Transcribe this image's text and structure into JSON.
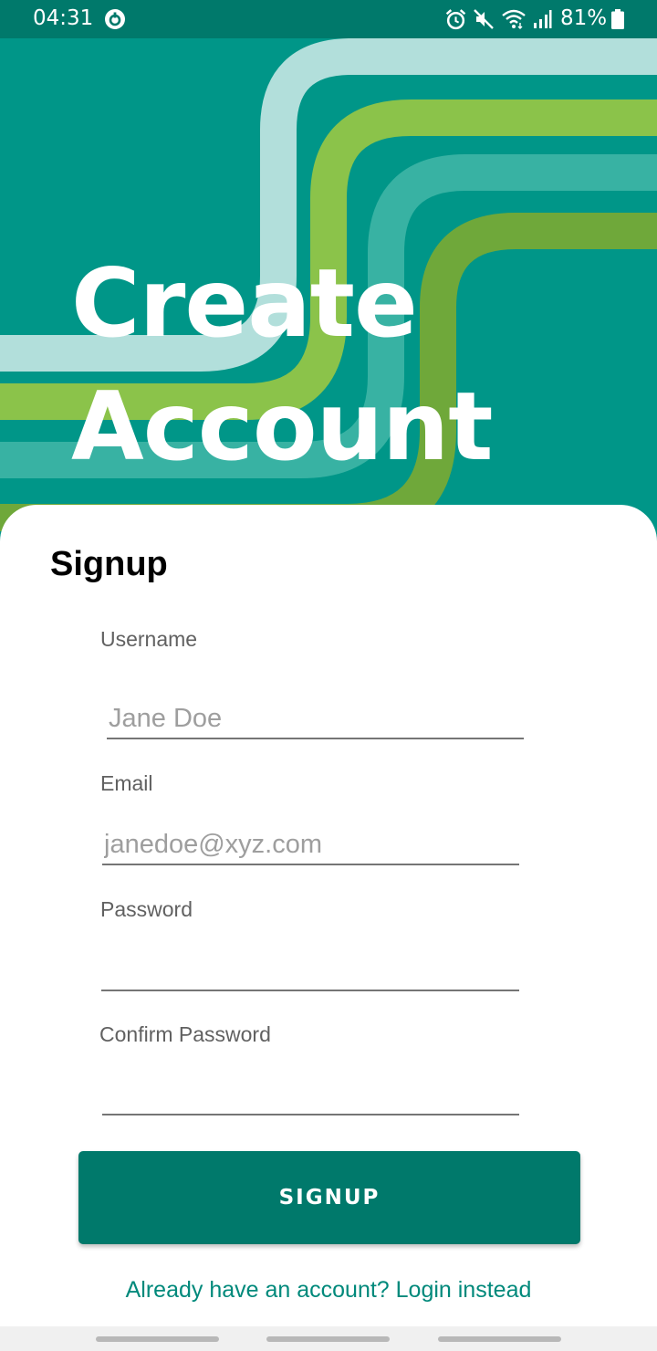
{
  "status_bar": {
    "time": "04:31",
    "battery": "81%",
    "icons": [
      "data-saver-icon",
      "alarm-icon",
      "mute-icon",
      "wifi-icon",
      "signal-icon",
      "battery-icon"
    ]
  },
  "header": {
    "title_line1": "Create",
    "title_line2": "Account"
  },
  "form": {
    "title": "Signup",
    "username": {
      "label": "Username",
      "placeholder": "Jane Doe",
      "value": ""
    },
    "email": {
      "label": "Email",
      "placeholder": "janedoe@xyz.com",
      "value": ""
    },
    "password": {
      "label": "Password",
      "value": ""
    },
    "confirm_password": {
      "label": "Confirm Password",
      "value": ""
    },
    "submit_label": "SIGNUP",
    "login_link": "Already have an account? Login instead"
  },
  "colors": {
    "primary_dark": "#00796b",
    "primary": "#009688",
    "stripe_light": "#b2dfdb",
    "stripe_green": "#8bc34a",
    "stripe_teal": "#38b2a3",
    "stripe_olive": "#6fa83a",
    "link": "#00897b"
  }
}
